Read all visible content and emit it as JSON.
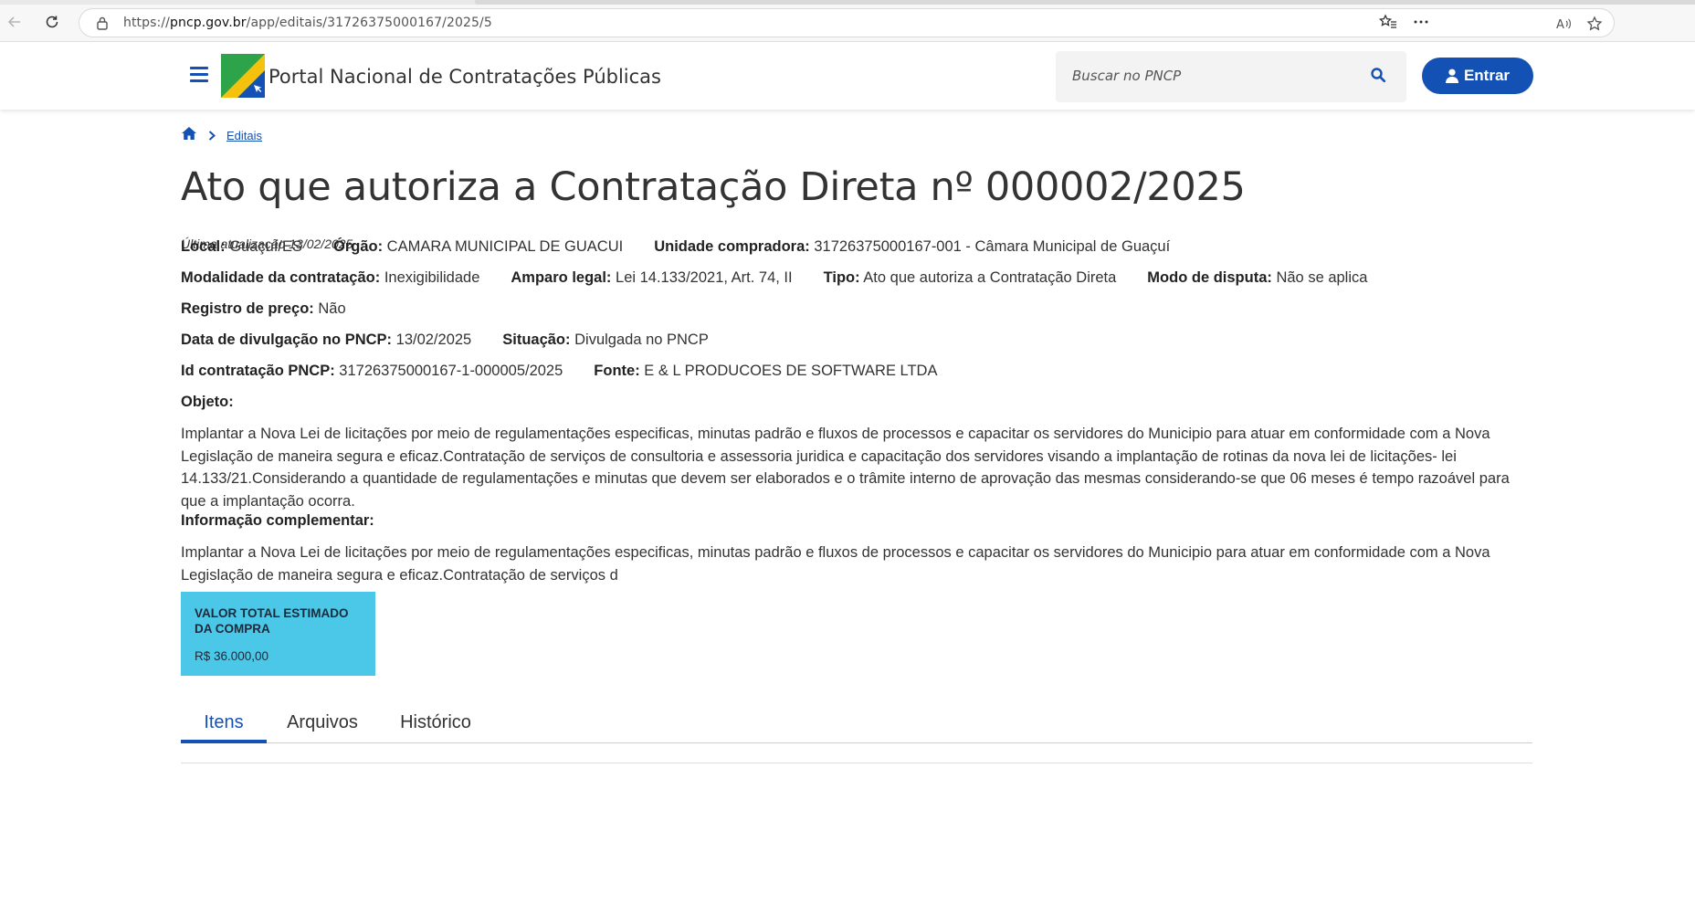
{
  "browser": {
    "url_scheme": "https://",
    "url_host": "pncp.gov.br",
    "url_path": "/app/editais/31726375000167/2025/5"
  },
  "header": {
    "site_title": "Portal Nacional de Contratações Públicas",
    "search_placeholder": "Buscar no PNCP",
    "login_label": "Entrar"
  },
  "breadcrumb": {
    "home_icon": "home-icon",
    "items": [
      "Editais"
    ]
  },
  "page": {
    "title": "Ato que autoriza a Contratação Direta nº 000002/2025",
    "updated": "Última atualização 13/02/2025"
  },
  "fields": {
    "local": {
      "label": "Local:",
      "value": "Guaçuí/ES"
    },
    "orgao": {
      "label": "Órgão:",
      "value": "CAMARA MUNICIPAL DE GUACUI"
    },
    "unidade": {
      "label": "Unidade compradora:",
      "value": "31726375000167-001 - Câmara Municipal de Guaçuí"
    },
    "modalidade": {
      "label": "Modalidade da contratação:",
      "value": "Inexigibilidade"
    },
    "amparo": {
      "label": "Amparo legal:",
      "value": "Lei 14.133/2021, Art. 74, II"
    },
    "tipo": {
      "label": "Tipo:",
      "value": "Ato que autoriza a Contratação Direta"
    },
    "modo_disputa": {
      "label": "Modo de disputa:",
      "value": "Não se aplica"
    },
    "registro_preco": {
      "label": "Registro de preço:",
      "value": "Não"
    },
    "data_divulgacao": {
      "label": "Data de divulgação no PNCP:",
      "value": "13/02/2025"
    },
    "situacao": {
      "label": "Situação:",
      "value": "Divulgada no PNCP"
    },
    "id_contratacao": {
      "label": "Id contratação PNCP:",
      "value": "31726375000167-1-000005/2025"
    },
    "fonte": {
      "label": "Fonte:",
      "value": "E & L PRODUCOES DE SOFTWARE LTDA"
    }
  },
  "objeto": {
    "label": "Objeto:",
    "text": "Implantar a Nova Lei de licitações por meio de regulamentações especificas, minutas padrão e fluxos de processos e capacitar os servidores do Municipio para atuar em conformidade com a Nova Legislação de maneira segura e eficaz.Contratação de serviços de consultoria e assessoria juridica e capacitação dos servidores visando a implantação de rotinas da nova lei de licitações- lei 14.133/21.Considerando a quantidade de regulamentações e minutas que devem ser elaborados e o trâmite interno de aprovação das mesmas considerando-se que 06 meses é tempo razoável para que a implantação ocorra."
  },
  "informacao_complementar": {
    "label": "Informação complementar:",
    "text": "Implantar a Nova Lei de licitações por meio de regulamentações especificas, minutas padrão e fluxos de processos e capacitar os servidores do Municipio para atuar em conformidade com a Nova Legislação de maneira segura e eficaz.Contratação de serviços d"
  },
  "valor_card": {
    "label": "VALOR TOTAL ESTIMADO DA COMPRA",
    "value": "R$ 36.000,00",
    "color": "#4bc8e8"
  },
  "tabs": [
    {
      "label": "Itens",
      "active": true
    },
    {
      "label": "Arquivos",
      "active": false
    },
    {
      "label": "Histórico",
      "active": false
    }
  ],
  "colors": {
    "primary": "#1351b4",
    "text": "#333333"
  }
}
